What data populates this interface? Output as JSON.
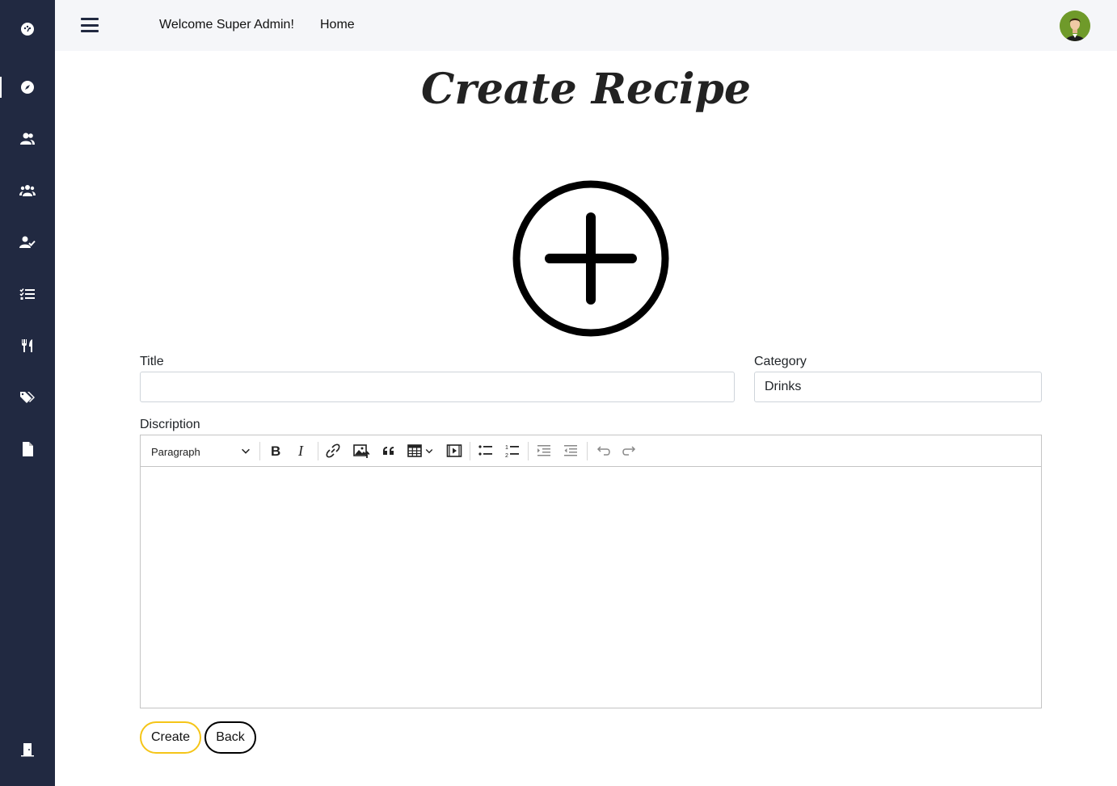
{
  "sidebar": {
    "items": [
      {
        "icon": "dashboard-icon"
      },
      {
        "icon": "compass-icon"
      },
      {
        "icon": "users-icon"
      },
      {
        "icon": "user-group-icon"
      },
      {
        "icon": "user-check-icon"
      },
      {
        "icon": "task-list-icon"
      },
      {
        "icon": "utensils-icon"
      },
      {
        "icon": "tags-icon"
      },
      {
        "icon": "file-icon"
      },
      {
        "icon": "logout-door-icon"
      }
    ],
    "active_index": 1,
    "background": "#212941"
  },
  "header": {
    "welcome": "Welcome Super Admin!",
    "home": "Home"
  },
  "page": {
    "title": "Create Recipe"
  },
  "form": {
    "title_label": "Title",
    "title_value": "",
    "category_label": "Category",
    "category_value": "Drinks",
    "description_label": "Discription",
    "editor": {
      "heading_select": "Paragraph",
      "tools": [
        "bold",
        "italic",
        "link",
        "insert-image",
        "block-quote",
        "insert-table",
        "media-embed",
        "bulleted-list",
        "numbered-list",
        "increase-indent",
        "decrease-indent",
        "undo",
        "redo"
      ]
    }
  },
  "actions": {
    "create": "Create",
    "back": "Back",
    "create_border_color": "#f5c518",
    "back_border_color": "#000000"
  }
}
